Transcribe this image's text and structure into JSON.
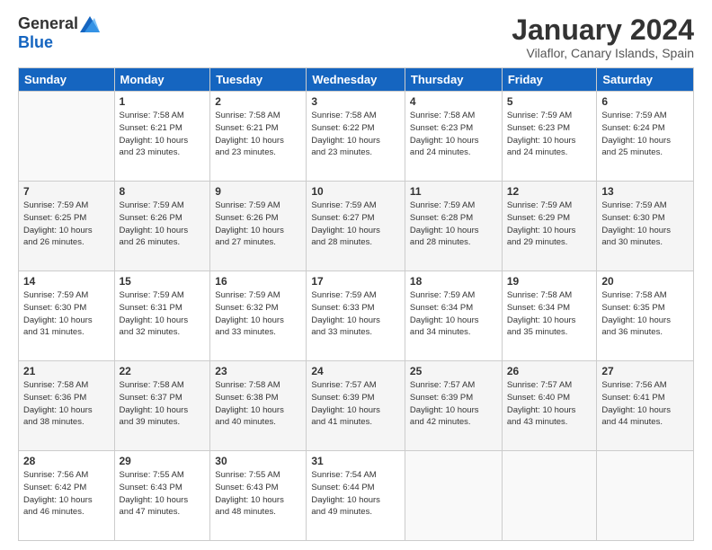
{
  "header": {
    "logo_general": "General",
    "logo_blue": "Blue",
    "month_year": "January 2024",
    "location": "Vilaflor, Canary Islands, Spain"
  },
  "days_of_week": [
    "Sunday",
    "Monday",
    "Tuesday",
    "Wednesday",
    "Thursday",
    "Friday",
    "Saturday"
  ],
  "weeks": [
    [
      {
        "day": "",
        "details": ""
      },
      {
        "day": "1",
        "details": "Sunrise: 7:58 AM\nSunset: 6:21 PM\nDaylight: 10 hours\nand 23 minutes."
      },
      {
        "day": "2",
        "details": "Sunrise: 7:58 AM\nSunset: 6:21 PM\nDaylight: 10 hours\nand 23 minutes."
      },
      {
        "day": "3",
        "details": "Sunrise: 7:58 AM\nSunset: 6:22 PM\nDaylight: 10 hours\nand 23 minutes."
      },
      {
        "day": "4",
        "details": "Sunrise: 7:58 AM\nSunset: 6:23 PM\nDaylight: 10 hours\nand 24 minutes."
      },
      {
        "day": "5",
        "details": "Sunrise: 7:59 AM\nSunset: 6:23 PM\nDaylight: 10 hours\nand 24 minutes."
      },
      {
        "day": "6",
        "details": "Sunrise: 7:59 AM\nSunset: 6:24 PM\nDaylight: 10 hours\nand 25 minutes."
      }
    ],
    [
      {
        "day": "7",
        "details": "Sunrise: 7:59 AM\nSunset: 6:25 PM\nDaylight: 10 hours\nand 26 minutes."
      },
      {
        "day": "8",
        "details": "Sunrise: 7:59 AM\nSunset: 6:26 PM\nDaylight: 10 hours\nand 26 minutes."
      },
      {
        "day": "9",
        "details": "Sunrise: 7:59 AM\nSunset: 6:26 PM\nDaylight: 10 hours\nand 27 minutes."
      },
      {
        "day": "10",
        "details": "Sunrise: 7:59 AM\nSunset: 6:27 PM\nDaylight: 10 hours\nand 28 minutes."
      },
      {
        "day": "11",
        "details": "Sunrise: 7:59 AM\nSunset: 6:28 PM\nDaylight: 10 hours\nand 28 minutes."
      },
      {
        "day": "12",
        "details": "Sunrise: 7:59 AM\nSunset: 6:29 PM\nDaylight: 10 hours\nand 29 minutes."
      },
      {
        "day": "13",
        "details": "Sunrise: 7:59 AM\nSunset: 6:30 PM\nDaylight: 10 hours\nand 30 minutes."
      }
    ],
    [
      {
        "day": "14",
        "details": "Sunrise: 7:59 AM\nSunset: 6:30 PM\nDaylight: 10 hours\nand 31 minutes."
      },
      {
        "day": "15",
        "details": "Sunrise: 7:59 AM\nSunset: 6:31 PM\nDaylight: 10 hours\nand 32 minutes."
      },
      {
        "day": "16",
        "details": "Sunrise: 7:59 AM\nSunset: 6:32 PM\nDaylight: 10 hours\nand 33 minutes."
      },
      {
        "day": "17",
        "details": "Sunrise: 7:59 AM\nSunset: 6:33 PM\nDaylight: 10 hours\nand 33 minutes."
      },
      {
        "day": "18",
        "details": "Sunrise: 7:59 AM\nSunset: 6:34 PM\nDaylight: 10 hours\nand 34 minutes."
      },
      {
        "day": "19",
        "details": "Sunrise: 7:58 AM\nSunset: 6:34 PM\nDaylight: 10 hours\nand 35 minutes."
      },
      {
        "day": "20",
        "details": "Sunrise: 7:58 AM\nSunset: 6:35 PM\nDaylight: 10 hours\nand 36 minutes."
      }
    ],
    [
      {
        "day": "21",
        "details": "Sunrise: 7:58 AM\nSunset: 6:36 PM\nDaylight: 10 hours\nand 38 minutes."
      },
      {
        "day": "22",
        "details": "Sunrise: 7:58 AM\nSunset: 6:37 PM\nDaylight: 10 hours\nand 39 minutes."
      },
      {
        "day": "23",
        "details": "Sunrise: 7:58 AM\nSunset: 6:38 PM\nDaylight: 10 hours\nand 40 minutes."
      },
      {
        "day": "24",
        "details": "Sunrise: 7:57 AM\nSunset: 6:39 PM\nDaylight: 10 hours\nand 41 minutes."
      },
      {
        "day": "25",
        "details": "Sunrise: 7:57 AM\nSunset: 6:39 PM\nDaylight: 10 hours\nand 42 minutes."
      },
      {
        "day": "26",
        "details": "Sunrise: 7:57 AM\nSunset: 6:40 PM\nDaylight: 10 hours\nand 43 minutes."
      },
      {
        "day": "27",
        "details": "Sunrise: 7:56 AM\nSunset: 6:41 PM\nDaylight: 10 hours\nand 44 minutes."
      }
    ],
    [
      {
        "day": "28",
        "details": "Sunrise: 7:56 AM\nSunset: 6:42 PM\nDaylight: 10 hours\nand 46 minutes."
      },
      {
        "day": "29",
        "details": "Sunrise: 7:55 AM\nSunset: 6:43 PM\nDaylight: 10 hours\nand 47 minutes."
      },
      {
        "day": "30",
        "details": "Sunrise: 7:55 AM\nSunset: 6:43 PM\nDaylight: 10 hours\nand 48 minutes."
      },
      {
        "day": "31",
        "details": "Sunrise: 7:54 AM\nSunset: 6:44 PM\nDaylight: 10 hours\nand 49 minutes."
      },
      {
        "day": "",
        "details": ""
      },
      {
        "day": "",
        "details": ""
      },
      {
        "day": "",
        "details": ""
      }
    ]
  ]
}
